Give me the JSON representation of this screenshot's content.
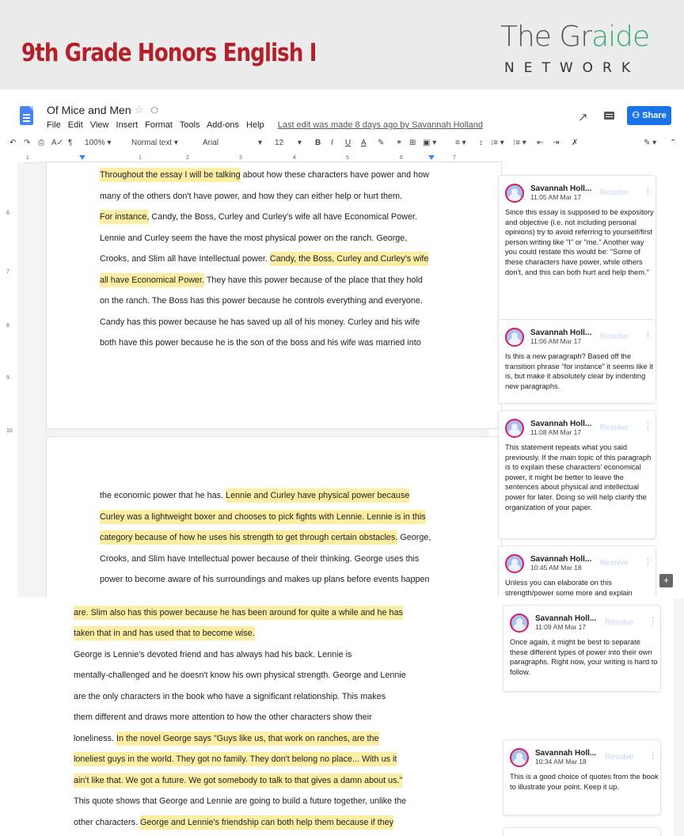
{
  "banner": {
    "title": "9th Grade Honors English I",
    "logo_a": "The Gr",
    "logo_b": "aide",
    "logo_sub": "NETWORK"
  },
  "doc": {
    "title": "Of Mice and Men",
    "menu": [
      "File",
      "Edit",
      "View",
      "Insert",
      "Format",
      "Tools",
      "Add-ons",
      "Help"
    ],
    "last_edit": "Last edit was made 8 days ago by Savannah Holland",
    "share_label": "Share"
  },
  "toolbar": {
    "zoom": "100%",
    "style": "Normal text",
    "font": "Arial",
    "size": "12"
  },
  "ruler": {
    "h_labels": [
      "1",
      "1",
      "2",
      "3",
      "4",
      "5",
      "6",
      "7"
    ],
    "v_labels": [
      "6",
      "7",
      "8",
      "9",
      "10"
    ]
  },
  "page1_lines": [
    {
      "segs": [
        {
          "t": "Throughout the essay I will be talking",
          "h": true
        },
        {
          "t": " about how these characters have power and how",
          "h": false
        }
      ]
    },
    {
      "segs": [
        {
          "t": "many of the others don't have power, and how they can either help or hurt them.",
          "h": false
        }
      ]
    },
    {
      "segs": [
        {
          "t": "For instance,",
          "h": true
        },
        {
          "t": " Candy, the Boss, Curley and Curley's wife all have Economical Power.",
          "h": false
        }
      ]
    },
    {
      "segs": [
        {
          "t": "Lennie and Curley seem the have the most physical power on the ranch. George,",
          "h": false
        }
      ]
    },
    {
      "segs": [
        {
          "t": "Crooks, and Slim all have Intellectual power. ",
          "h": false
        },
        {
          "t": "Candy, the Boss, Curley and Curley's wife",
          "h": true
        }
      ]
    },
    {
      "segs": [
        {
          "t": "all have Economical Power.",
          "h": true
        },
        {
          "t": " They have this power because of the place that they hold",
          "h": false
        }
      ]
    },
    {
      "segs": [
        {
          "t": "on the ranch. The Boss has this power because he controls everything and everyone.",
          "h": false
        }
      ]
    },
    {
      "segs": [
        {
          "t": "Candy has this power because he has saved up all of his money. Curley and his wife",
          "h": false
        }
      ]
    },
    {
      "segs": [
        {
          "t": "both have this power because he is the son of the boss and his wife was married into",
          "h": false
        }
      ]
    }
  ],
  "page2_lines": [
    {
      "segs": [
        {
          "t": "the economic power that he has. ",
          "h": false
        },
        {
          "t": "Lennie and Curley have physical power because",
          "h": true
        }
      ]
    },
    {
      "segs": [
        {
          "t": "Curley was a lightweight boxer and chooses to pick fights with Lennie. Lennie is in this",
          "h": true
        }
      ]
    },
    {
      "segs": [
        {
          "t": "category because of how he uses his strength to get through certain obstacles.",
          "h": true
        },
        {
          "t": " George,",
          "h": false
        }
      ]
    },
    {
      "segs": [
        {
          "t": "Crooks, and Slim have Intellectual power because of their thinking. George uses this",
          "h": false
        }
      ]
    },
    {
      "segs": [
        {
          "t": "power to become aware of his surroundings and makes up plans before events happen",
          "h": false
        }
      ]
    }
  ],
  "comments1": [
    {
      "author": "Savannah Holl...",
      "time": "11:05 AM Mar 17",
      "resolve": "Resolve",
      "body": "Since this essay is supposed to be expository and objective (i.e. not including personal opinions) try to avoid referring to yourself/first person writing like \"I\" or \"me.\" Another way you could restate this would be: \"Some of these characters have power, while others don't, and this can both hurt and help them.\""
    },
    {
      "author": "Savannah Holl...",
      "time": "11:06 AM Mar 17",
      "resolve": "Resolve",
      "body": "Is this a new paragraph? Based off the transition phrase \"for instance\" it seems like it is, but make it absolutely clear by indenting new paragraphs."
    },
    {
      "author": "Savannah Holl...",
      "time": "11:08 AM Mar 17",
      "resolve": "Resolve",
      "body": "This statement repeats what you said previously. If the main topic of this paragraph is to explain these characters' economical power, it might be better to leave the sentences about physical and intellectual power for later. Doing so will help clarify the organization of your paper."
    },
    {
      "author": "Savannah Holl...",
      "time": "10:45 AM Mar 18",
      "resolve": "Resolve",
      "body": "Unless you can elaborate on this strength/power some more and explain"
    }
  ],
  "shot2_lines": [
    {
      "segs": [
        {
          "t": "are. Slim also has this power because he has been around for quite a while and he has",
          "h": true
        }
      ]
    },
    {
      "segs": [
        {
          "t": "taken that in and has used that to become wise.",
          "h": true
        }
      ]
    },
    {
      "segs": [
        {
          "t": "        George is Lennie's devoted friend and has always had his back. Lennie is",
          "h": false
        }
      ]
    },
    {
      "segs": [
        {
          "t": "mentally-challenged and he doesn't know his own physical strength. George and Lennie",
          "h": false
        }
      ]
    },
    {
      "segs": [
        {
          "t": "are the only characters in the book who have a significant relationship. This makes",
          "h": false
        }
      ]
    },
    {
      "segs": [
        {
          "t": "them different and draws more attention to how the other characters show their",
          "h": false
        }
      ]
    },
    {
      "segs": [
        {
          "t": "loneliness. ",
          "h": false
        },
        {
          "t": "In the novel George says \"Guys like us, that work on ranches, are the",
          "h": true
        }
      ]
    },
    {
      "segs": [
        {
          "t": "loneliest guys in the world. They got no family. They don't belong no place... With us it",
          "h": true
        }
      ]
    },
    {
      "segs": [
        {
          "t": "ain't like that. We got a future. We got somebody to talk to that gives a damn about us.\"",
          "h": true
        }
      ]
    },
    {
      "segs": [
        {
          "t": "This quote shows that George and Lennie are going to build a future together, unlike the",
          "h": false
        }
      ]
    },
    {
      "segs": [
        {
          "t": "other characters. ",
          "h": false
        },
        {
          "t": "George and Lennie's friendship can both help them because if they",
          "h": true
        }
      ]
    }
  ],
  "comments2": [
    {
      "author": "Savannah Holl...",
      "time": "11:09 AM Mar 17",
      "resolve": "Resolve",
      "body": "Once again, it might be best to separate these different types of power into their own paragraphs. Right now, your writing is hard to follow."
    },
    {
      "author": "Savannah Holl...",
      "time": "10:34 AM Mar 18",
      "resolve": "Resolve",
      "body": "This is a good choice of quotes from the book to illustrate your point. Keep it up."
    }
  ]
}
